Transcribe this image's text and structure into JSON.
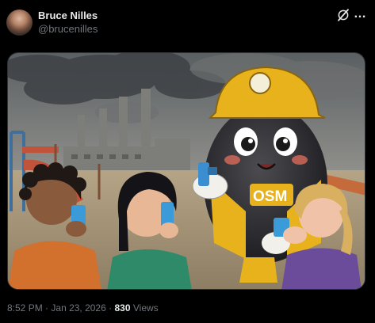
{
  "author": {
    "display_name": "Bruce Nilles",
    "handle": "@brucenilles"
  },
  "header_icons": [
    "grok-icon",
    "more-options-icon"
  ],
  "more_label": "…",
  "image": {
    "description_icon": "illustration",
    "badge_text": "OSM"
  },
  "meta": {
    "time": "8:52 PM",
    "separator": "·",
    "date": "Jan 23, 2026",
    "views_count": "830",
    "views_label": "Views"
  }
}
